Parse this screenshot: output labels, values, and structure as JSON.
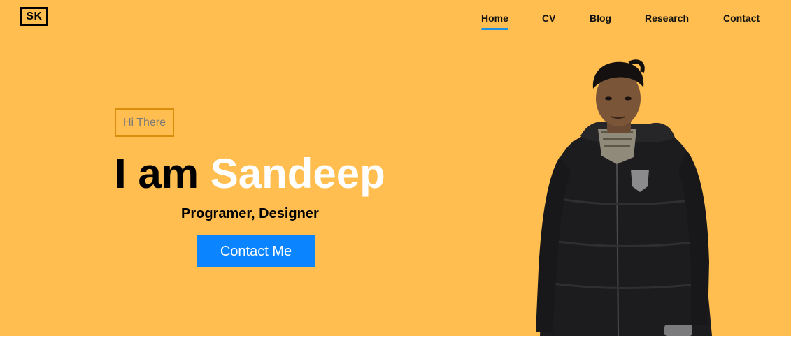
{
  "header": {
    "logo_text": "SK",
    "nav": [
      {
        "label": "Home",
        "active": true
      },
      {
        "label": "CV",
        "active": false
      },
      {
        "label": "Blog",
        "active": false
      },
      {
        "label": "Research",
        "active": false
      },
      {
        "label": "Contact",
        "active": false
      }
    ]
  },
  "hero": {
    "greeting": "Hi There",
    "headline_prefix": "I am",
    "headline_name": "Sandeep",
    "subtitle": "Programer, Designer",
    "cta_label": "Contact Me",
    "portrait_icon": "person-photo"
  },
  "colors": {
    "background": "#FFBE4F",
    "accent_blue": "#0A84FF",
    "nav_underline": "#1E8FE1",
    "greeting_border": "#D98E0B",
    "name_color": "#FFFFFF"
  }
}
